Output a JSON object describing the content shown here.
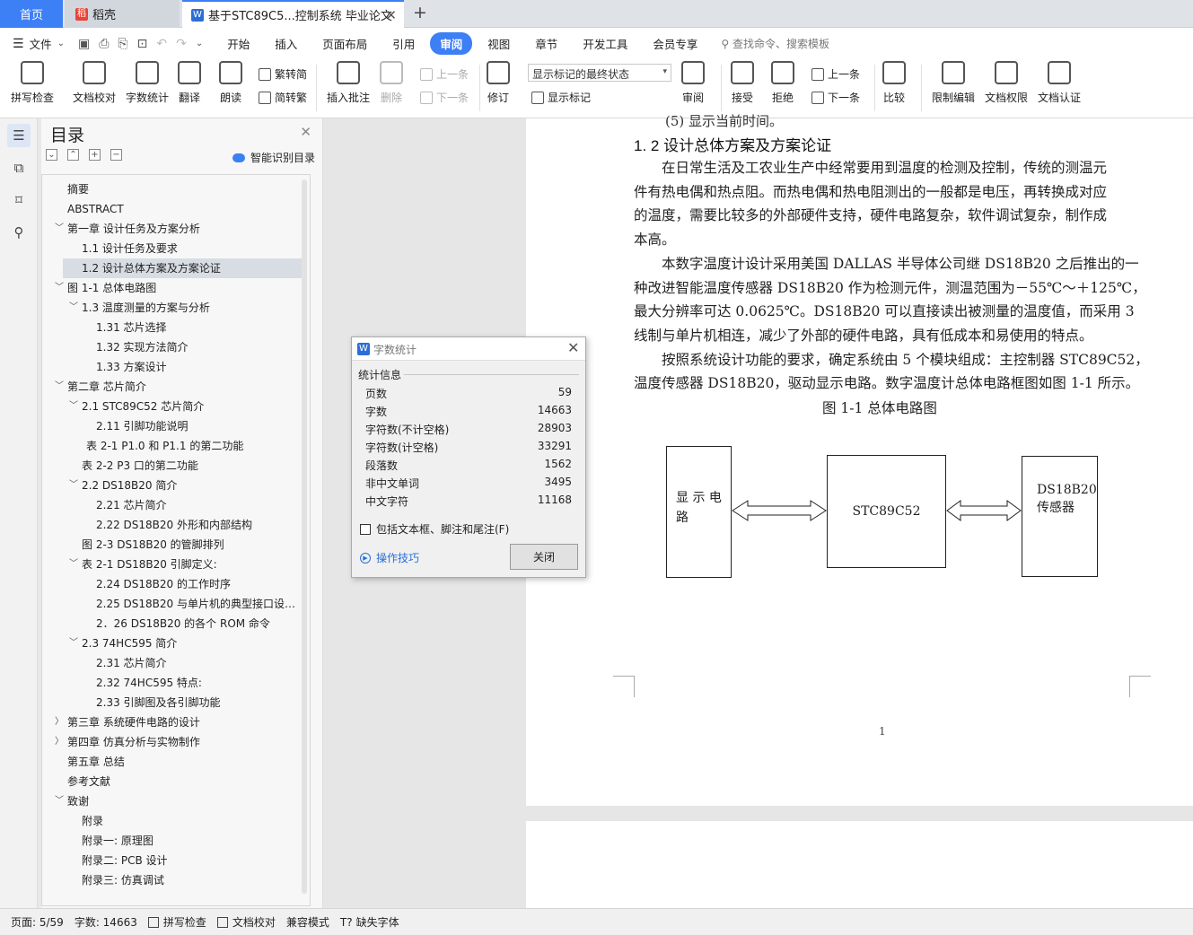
{
  "tabs": {
    "home": "首页",
    "daoke": "稻壳",
    "doc": "基于STC89C5...控制系统 毕业论文"
  },
  "menu": {
    "file": "文件",
    "tabs": [
      "开始",
      "插入",
      "页面布局",
      "引用",
      "审阅",
      "视图",
      "章节",
      "开发工具",
      "会员专享"
    ],
    "active_tab": "审阅",
    "search": "查找命令、搜索模板"
  },
  "ribbon": {
    "spell": "拼写检查",
    "proof": "文档校对",
    "wordcount": "字数统计",
    "translate": "翻译",
    "read": "朗读",
    "trad": "繁转简",
    "simp": "简转繁",
    "insert_comment": "插入批注",
    "delete": "删除",
    "prev_comment": "上一条",
    "next_comment": "下一条",
    "revise": "修订",
    "mark_state": "显示标记的最终状态",
    "show_marks": "显示标记",
    "review": "审阅",
    "accept": "接受",
    "reject": "拒绝",
    "prev": "上一条",
    "next": "下一条",
    "compare": "比较",
    "restrict": "限制编辑",
    "perm": "文档权限",
    "auth": "文档认证"
  },
  "toc": {
    "title": "目录",
    "smart": "智能识别目录",
    "items": [
      {
        "label": "摘要",
        "level": 1,
        "exp": ""
      },
      {
        "label": "ABSTRACT",
        "level": 1,
        "exp": ""
      },
      {
        "label": "第一章  设计任务及方案分析",
        "level": 1,
        "exp": "v"
      },
      {
        "label": "1.1  设计任务及要求",
        "level": 2,
        "exp": ""
      },
      {
        "label": "1.2  设计总体方案及方案论证",
        "level": 2,
        "exp": "",
        "sel": true
      },
      {
        "label": "图 1-1  总体电路图",
        "level": 1,
        "exp": "v"
      },
      {
        "label": "1.3  温度测量的方案与分析",
        "level": 2,
        "exp": "v"
      },
      {
        "label": "1.31 芯片选择",
        "level": 3,
        "exp": ""
      },
      {
        "label": "1.32 实现方法简介",
        "level": 3,
        "exp": ""
      },
      {
        "label": "1.33  方案设计",
        "level": 3,
        "exp": ""
      },
      {
        "label": "第二章  芯片简介",
        "level": 1,
        "exp": "v"
      },
      {
        "label": "2.1 STC89C52 芯片简介",
        "level": 2,
        "exp": "v"
      },
      {
        "label": "2.11 引脚功能说明",
        "level": 3,
        "exp": ""
      },
      {
        "label": "表 2-1  P1.0 和 P1.1 的第二功能",
        "level": 2.3,
        "exp": ""
      },
      {
        "label": "表 2-2    P3 口的第二功能",
        "level": 2,
        "exp": ""
      },
      {
        "label": "2.2 DS18B20 简介",
        "level": 2,
        "exp": "v"
      },
      {
        "label": "2.21 芯片简介",
        "level": 3,
        "exp": ""
      },
      {
        "label": "2.22 DS18B20 外形和内部结构",
        "level": 3,
        "exp": ""
      },
      {
        "label": "图 2-3    DS18B20 的管脚排列",
        "level": 2,
        "exp": ""
      },
      {
        "label": "表 2-1    DS18B20 引脚定义:",
        "level": 2,
        "exp": "v"
      },
      {
        "label": "2.24    DS18B20 的工作时序",
        "level": 3,
        "exp": ""
      },
      {
        "label": "2.25 DS18B20 与单片机的典型接口设…",
        "level": 3,
        "exp": ""
      },
      {
        "label": "2．26 DS18B20 的各个 ROM  命令",
        "level": 3,
        "exp": ""
      },
      {
        "label": "2.3 74HC595 简介",
        "level": 2,
        "exp": "v"
      },
      {
        "label": "2.31 芯片简介",
        "level": 3,
        "exp": ""
      },
      {
        "label": "2.32    74HC595 特点:",
        "level": 3,
        "exp": ""
      },
      {
        "label": "2.33    引脚图及各引脚功能",
        "level": 3,
        "exp": ""
      },
      {
        "label": "第三章  系统硬件电路的设计",
        "level": 1,
        "exp": ">"
      },
      {
        "label": "第四章  仿真分析与实物制作",
        "level": 1,
        "exp": ">"
      },
      {
        "label": "第五章  总结",
        "level": 1,
        "exp": ""
      },
      {
        "label": "参考文献",
        "level": 1,
        "exp": ""
      },
      {
        "label": "致谢",
        "level": 1,
        "exp": "v"
      },
      {
        "label": "附录",
        "level": 2,
        "exp": ""
      },
      {
        "label": "附录一:  原理图",
        "level": 2,
        "exp": ""
      },
      {
        "label": "附录二:  PCB 设计",
        "level": 2,
        "exp": ""
      },
      {
        "label": "附录三:  仿真调试",
        "level": 2,
        "exp": ""
      }
    ]
  },
  "document": {
    "cutoff_line": "(5) 显示当前时间。",
    "heading": "1. 2  设计总体方案及方案论证",
    "lines": [
      "　　在日常生活及工农业生产中经常要用到温度的检测及控制，传统的测温元",
      "件有热电偶和热点阻。而热电偶和热电阻测出的一般都是电压，再转换成对应",
      "的温度，需要比较多的外部硬件支持，硬件电路复杂，软件调试复杂，制作成",
      "本高。",
      "　　本数字温度计设计采用美国 DALLAS 半导体公司继 DS18B20 之后推出的一",
      "种改进智能温度传感器 DS18B20 作为检测元件，测温范围为－55℃～＋125℃，",
      "最大分辨率可达 0.0625℃。DS18B20 可以直接读出被测量的温度值，而采用 3",
      "线制与单片机相连，减少了外部的硬件电路，具有低成本和易使用的特点。",
      "　　按照系统设计功能的要求，确定系统由 5 个模块组成：主控制器 STC89C52，",
      "温度传感器 DS18B20，驱动显示电路。数字温度计总体电路框图如图 1-1 所示。"
    ],
    "figure_caption": "图 1-1  总体电路图",
    "diagram": {
      "box1": "显 示 电\n路",
      "box2": "STC89C52",
      "box3": "DS18B20\n传感器"
    },
    "page_number": "1"
  },
  "dialog": {
    "title": "字数统计",
    "section": "统计信息",
    "rows": [
      {
        "label": "页数",
        "value": "59"
      },
      {
        "label": "字数",
        "value": "14663"
      },
      {
        "label": "字符数(不计空格)",
        "value": "28903"
      },
      {
        "label": "字符数(计空格)",
        "value": "33291"
      },
      {
        "label": "段落数",
        "value": "1562"
      },
      {
        "label": "非中文单词",
        "value": "3495"
      },
      {
        "label": "中文字符",
        "value": "11168"
      }
    ],
    "checkbox": "包括文本框、脚注和尾注(F)",
    "tips": "操作技巧",
    "close": "关闭"
  },
  "status": {
    "page": "页面: 5/59",
    "words": "字数: 14663",
    "spell": "拼写检查",
    "proof": "文档校对",
    "compat": "兼容模式",
    "missing_font": "缺失字体"
  },
  "colors": {
    "accent": "#3d7ff5"
  }
}
